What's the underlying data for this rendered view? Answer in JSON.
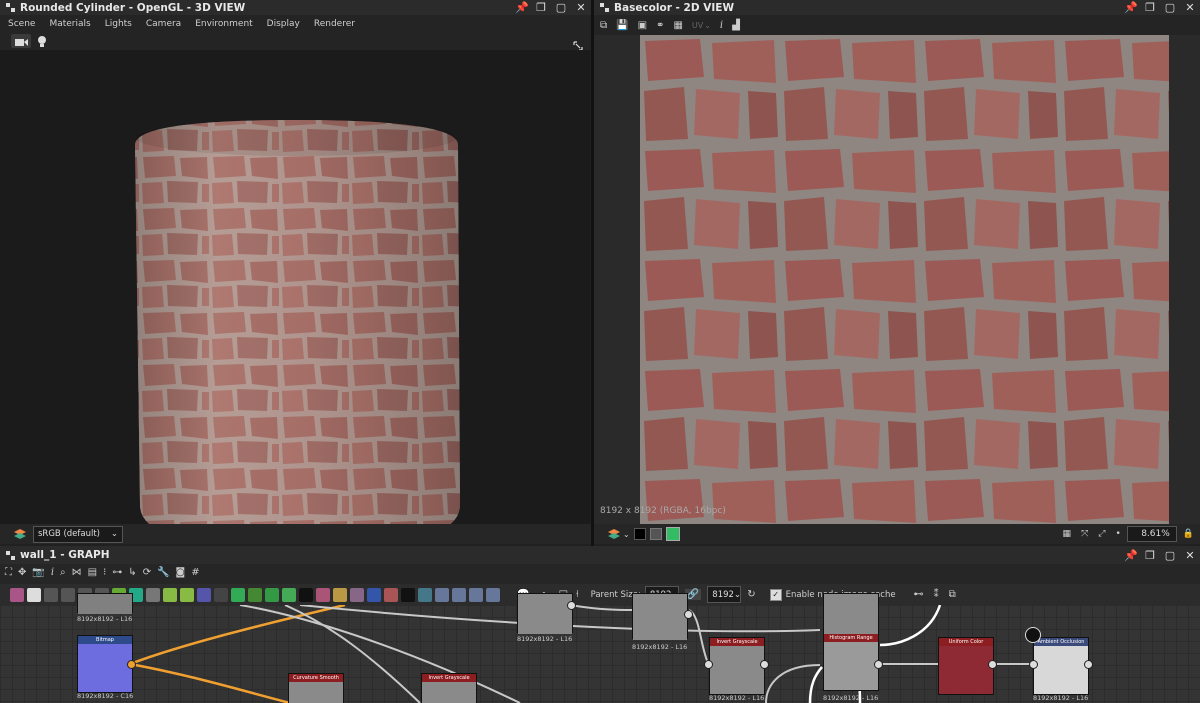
{
  "view3d": {
    "title": "Rounded Cylinder - OpenGL - 3D VIEW",
    "menu": [
      "Scene",
      "Materials",
      "Lights",
      "Camera",
      "Environment",
      "Display",
      "Renderer"
    ],
    "colorspace": "sRGB (default)"
  },
  "view2d": {
    "title": "Basecolor - 2D VIEW",
    "uv_label": "UV",
    "resolution_info": "8192 x 8192 (RGBA, 16bpc)",
    "zoom": "8.61%"
  },
  "graph": {
    "title": "wall_1 - GRAPH",
    "parent_size_label": "Parent Size:",
    "parent_size_value": "8192",
    "size_value": "8192",
    "cache_label": "Enable node image cache",
    "cache_enabled": true,
    "nodes": [
      {
        "title": "Bitmap",
        "label": "8192x8192 - C16"
      },
      {
        "title": "Curvature Smooth",
        "label": ""
      },
      {
        "title": "Invert Grayscale",
        "label": ""
      },
      {
        "title": "",
        "label": "8192x8192 - L16"
      },
      {
        "title": "",
        "label": "8192x8192 - L16"
      },
      {
        "title": "Invert Grayscale",
        "label": "8192x8192 - L16"
      },
      {
        "title": "Histogram Range",
        "label": "8192x8192 - L16"
      },
      {
        "title": "Uniform Color",
        "label": ""
      },
      {
        "title": "Ambient Occlusion",
        "label": "8192x8192 - L16"
      },
      {
        "title": "",
        "label": "8192x8192 - L16"
      }
    ],
    "node_colors": {
      "header": "#8c1d20",
      "normal": "#6a6ad8",
      "uniform": "#8e2a33"
    }
  },
  "icons": [
    "pin-icon",
    "restore-icon",
    "maximize-icon",
    "close-icon",
    "camera-icon",
    "light-icon",
    "info-icon",
    "histogram-icon"
  ]
}
